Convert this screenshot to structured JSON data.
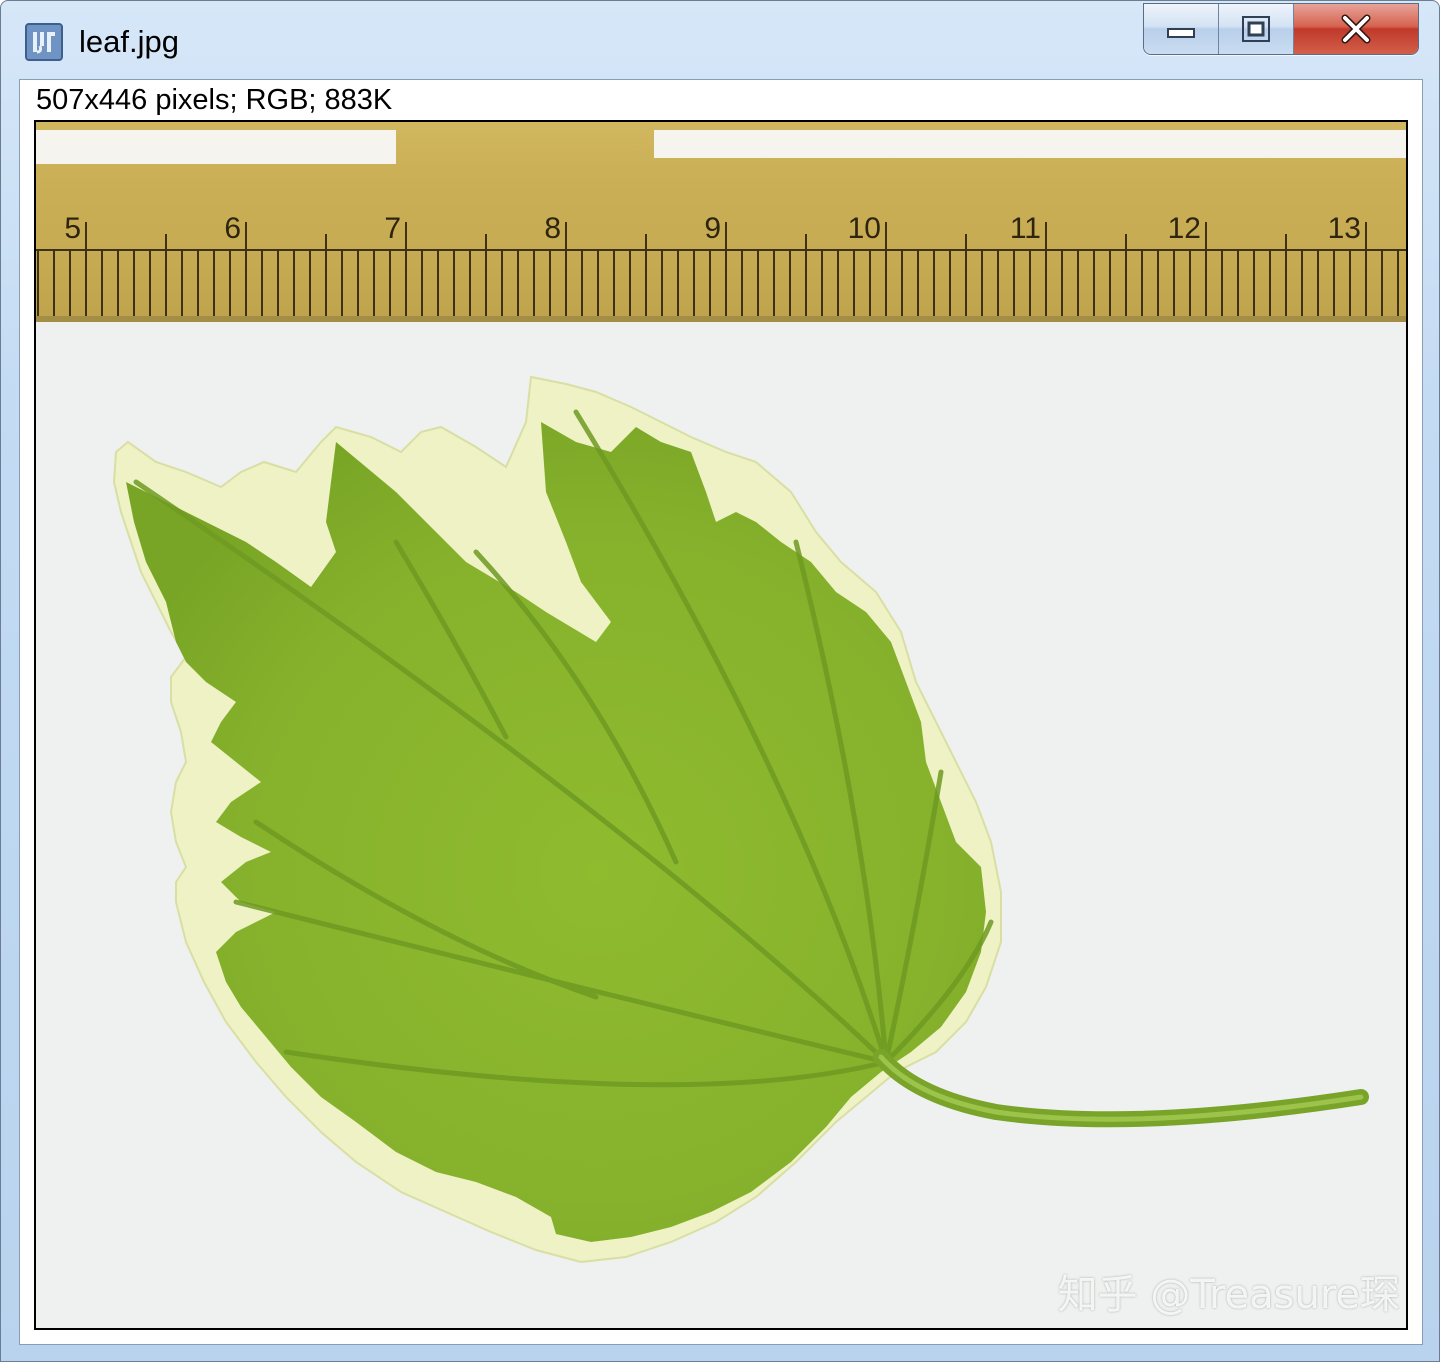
{
  "window": {
    "title": "leaf.jpg",
    "icon": "imagej-icon",
    "buttons": {
      "minimize": "minimize-icon",
      "maximize": "maximize-icon",
      "close": "close-icon"
    }
  },
  "image_info": "507x446 pixels; RGB; 883K",
  "ruler": {
    "labels": [
      "5",
      "6",
      "7",
      "8",
      "9",
      "10",
      "11",
      "12",
      "13"
    ]
  },
  "watermark": "知乎 @Treasure琛",
  "colors": {
    "ruler": "#c9ae55",
    "leaf_green": "#8cb82e",
    "leaf_margin": "#eef2c4",
    "background": "#eef1ef"
  }
}
